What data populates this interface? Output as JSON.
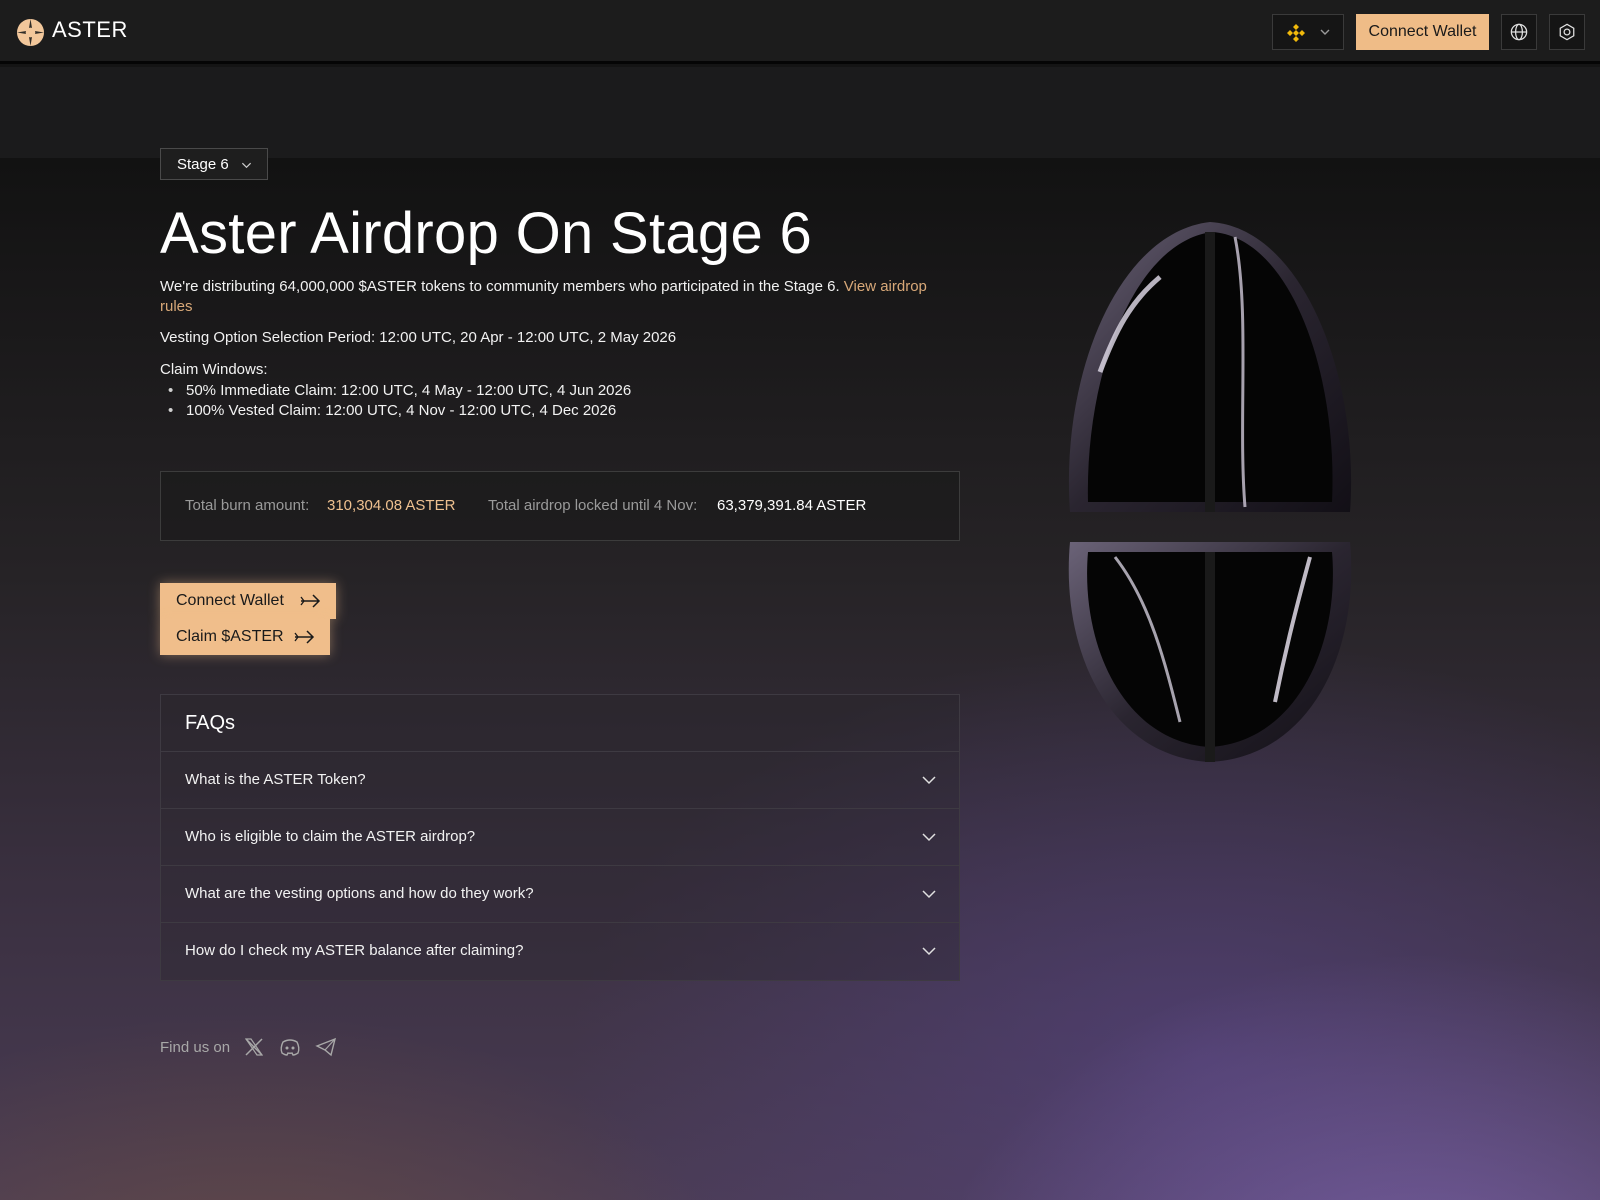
{
  "header": {
    "brand": "ASTER",
    "connect_wallet": "Connect Wallet"
  },
  "stage_select": {
    "value": "Stage 6"
  },
  "title": "Aster Airdrop On Stage 6",
  "intro": {
    "text": "We're distributing 64,000,000 $ASTER tokens to community members who participated in the Stage 6. ",
    "link": "View airdrop rules"
  },
  "vesting_period": "Vesting Option Selection Period: 12:00 UTC, 20 Apr - 12:00 UTC, 2 May 2026",
  "claim_windows": {
    "title": "Claim Windows:",
    "items": [
      "50% Immediate Claim: 12:00 UTC, 4 May - 12:00 UTC, 4 Jun 2026",
      "100% Vested Claim: 12:00 UTC, 4 Nov - 12:00 UTC, 4 Dec 2026"
    ]
  },
  "stats": {
    "burn_label": "Total burn amount:",
    "burn_value": "310,304.08 ASTER",
    "locked_label": "Total airdrop locked until 4 Nov:",
    "locked_value": "63,379,391.84 ASTER"
  },
  "actions": {
    "connect_wallet": "Connect Wallet",
    "claim": "Claim $ASTER"
  },
  "faq": {
    "title": "FAQs",
    "items": [
      "What is the ASTER Token?",
      "Who is eligible to claim the ASTER airdrop?",
      "What are the vesting options and how do they work?",
      "How do I check my ASTER balance after claiming?"
    ]
  },
  "social": {
    "label": "Find us on",
    "icons": [
      "x-icon",
      "discord-icon",
      "telegram-icon"
    ]
  },
  "colors": {
    "accent": "#efbc87",
    "link": "#d8a878",
    "burn_value": "#efc190",
    "chain_coin": "#f0b90b"
  }
}
